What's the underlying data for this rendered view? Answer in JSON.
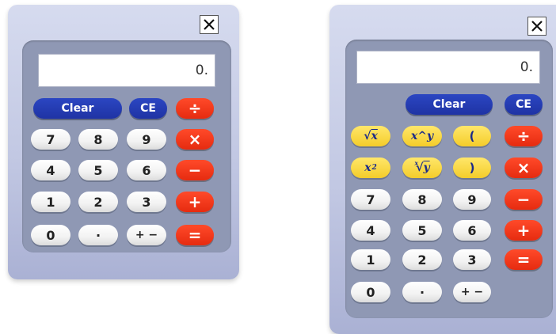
{
  "basic": {
    "display_value": "0.",
    "keys": {
      "clear": "Clear",
      "ce": "CE",
      "divide": "÷",
      "multiply": "×",
      "subtract": "−",
      "add": "+",
      "equals": "=",
      "seven": "7",
      "eight": "8",
      "nine": "9",
      "four": "4",
      "five": "5",
      "six": "6",
      "one": "1",
      "two": "2",
      "three": "3",
      "zero": "0",
      "decimal": "·",
      "sign": "+ −"
    }
  },
  "scientific": {
    "display_value": "0.",
    "keys": {
      "clear": "Clear",
      "ce": "CE",
      "sqrt_x": "x",
      "x_pow_y": "x^y",
      "open_paren": "(",
      "close_paren": ")",
      "x_squared_base": "x",
      "x_squared_exp": "2",
      "root_index": "x",
      "root_base": "y",
      "divide": "÷",
      "multiply": "×",
      "subtract": "−",
      "add": "+",
      "equals": "=",
      "seven": "7",
      "eight": "8",
      "nine": "9",
      "four": "4",
      "five": "5",
      "six": "6",
      "one": "1",
      "two": "2",
      "three": "3",
      "zero": "0",
      "decimal": "·",
      "sign": "+ −"
    }
  },
  "colors": {
    "body_light": "#d6dbef",
    "panel": "#8f98b4",
    "blue_key": "#2236b0",
    "red_key": "#f0361a",
    "yellow_key": "#f7d63e",
    "white_key": "#f6f6f6"
  },
  "icons": {
    "close": "close-x-icon"
  }
}
